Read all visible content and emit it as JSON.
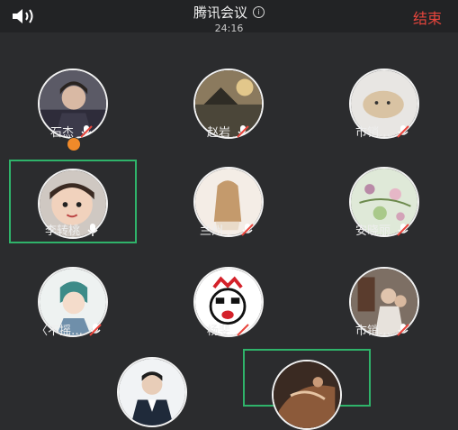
{
  "header": {
    "title": "腾讯会议",
    "timer": "24:16",
    "end_label": "结束"
  },
  "participants": [
    {
      "name": "石杰",
      "mic": "muted",
      "host": true,
      "active": false
    },
    {
      "name": "赵岩",
      "mic": "muted",
      "host": false,
      "active": false
    },
    {
      "name": "市销…",
      "mic": "muted",
      "host": false,
      "active": false
    },
    {
      "name": "李转桃",
      "mic": "on",
      "host": false,
      "active": true
    },
    {
      "name": "兰州…",
      "mic": "muted",
      "host": false,
      "active": false
    },
    {
      "name": "安晓丽",
      "mic": "muted",
      "host": false,
      "active": false
    },
    {
      "name": "〈不摇…",
      "mic": "muted",
      "host": false,
      "active": false
    },
    {
      "name": "杨斐",
      "mic": "muted",
      "host": false,
      "active": false
    },
    {
      "name": "市销…",
      "mic": "muted",
      "host": false,
      "active": false
    },
    {
      "name": "",
      "mic": "",
      "host": false,
      "active": false
    },
    {
      "name": "",
      "mic": "",
      "host": false,
      "active": true
    }
  ],
  "colors": {
    "background": "#2b2c2e",
    "topbar": "#222325",
    "end": "#e8453c",
    "active_border": "#2fb36a",
    "mic_muted": "#e8453c"
  }
}
